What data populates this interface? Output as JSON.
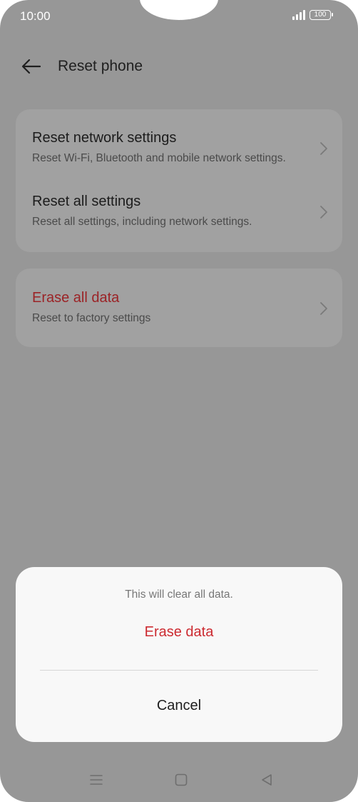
{
  "status_bar": {
    "time": "10:00",
    "battery": "100",
    "icons": [
      "signal-icon",
      "battery-icon"
    ]
  },
  "header": {
    "back_icon": "arrow-left-icon",
    "title": "Reset phone"
  },
  "group1": [
    {
      "title": "Reset network settings",
      "subtitle": "Reset Wi-Fi, Bluetooth and mobile network settings."
    },
    {
      "title": "Reset all settings",
      "subtitle": "Reset all settings, including network settings."
    }
  ],
  "group2": {
    "title": "Erase all data",
    "subtitle": "Reset to factory settings"
  },
  "dialog": {
    "message": "This will clear all data.",
    "erase_label": "Erase data",
    "cancel_label": "Cancel"
  },
  "navbar": {
    "icons": [
      "menu-icon",
      "home-square-icon",
      "back-triangle-icon"
    ]
  },
  "colors": {
    "scrim": "#979797",
    "danger": "#cc2a30",
    "dialog_bg": "#f8f8f8"
  }
}
